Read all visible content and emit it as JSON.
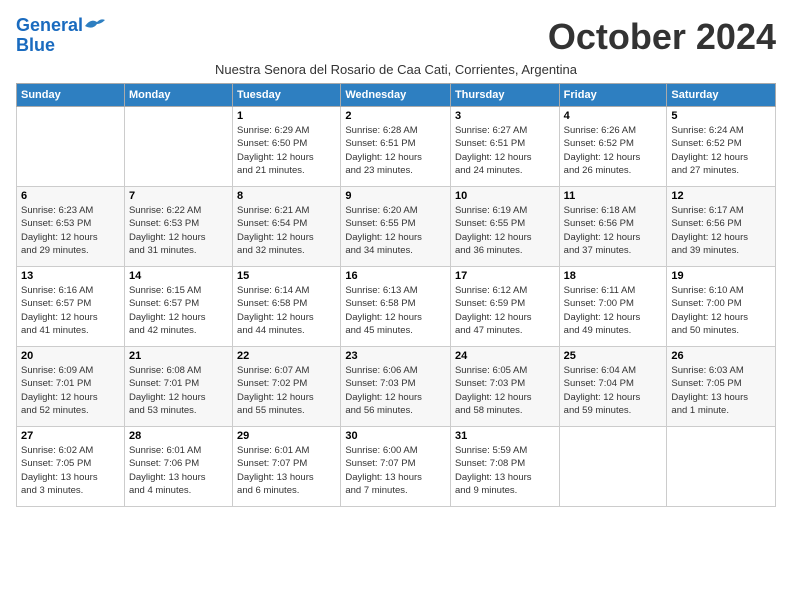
{
  "header": {
    "logo_line1": "General",
    "logo_line2": "Blue",
    "month_title": "October 2024",
    "subtitle": "Nuestra Senora del Rosario de Caa Cati, Corrientes, Argentina"
  },
  "weekdays": [
    "Sunday",
    "Monday",
    "Tuesday",
    "Wednesday",
    "Thursday",
    "Friday",
    "Saturday"
  ],
  "weeks": [
    [
      {
        "day": "",
        "info": ""
      },
      {
        "day": "",
        "info": ""
      },
      {
        "day": "1",
        "info": "Sunrise: 6:29 AM\nSunset: 6:50 PM\nDaylight: 12 hours\nand 21 minutes."
      },
      {
        "day": "2",
        "info": "Sunrise: 6:28 AM\nSunset: 6:51 PM\nDaylight: 12 hours\nand 23 minutes."
      },
      {
        "day": "3",
        "info": "Sunrise: 6:27 AM\nSunset: 6:51 PM\nDaylight: 12 hours\nand 24 minutes."
      },
      {
        "day": "4",
        "info": "Sunrise: 6:26 AM\nSunset: 6:52 PM\nDaylight: 12 hours\nand 26 minutes."
      },
      {
        "day": "5",
        "info": "Sunrise: 6:24 AM\nSunset: 6:52 PM\nDaylight: 12 hours\nand 27 minutes."
      }
    ],
    [
      {
        "day": "6",
        "info": "Sunrise: 6:23 AM\nSunset: 6:53 PM\nDaylight: 12 hours\nand 29 minutes."
      },
      {
        "day": "7",
        "info": "Sunrise: 6:22 AM\nSunset: 6:53 PM\nDaylight: 12 hours\nand 31 minutes."
      },
      {
        "day": "8",
        "info": "Sunrise: 6:21 AM\nSunset: 6:54 PM\nDaylight: 12 hours\nand 32 minutes."
      },
      {
        "day": "9",
        "info": "Sunrise: 6:20 AM\nSunset: 6:55 PM\nDaylight: 12 hours\nand 34 minutes."
      },
      {
        "day": "10",
        "info": "Sunrise: 6:19 AM\nSunset: 6:55 PM\nDaylight: 12 hours\nand 36 minutes."
      },
      {
        "day": "11",
        "info": "Sunrise: 6:18 AM\nSunset: 6:56 PM\nDaylight: 12 hours\nand 37 minutes."
      },
      {
        "day": "12",
        "info": "Sunrise: 6:17 AM\nSunset: 6:56 PM\nDaylight: 12 hours\nand 39 minutes."
      }
    ],
    [
      {
        "day": "13",
        "info": "Sunrise: 6:16 AM\nSunset: 6:57 PM\nDaylight: 12 hours\nand 41 minutes."
      },
      {
        "day": "14",
        "info": "Sunrise: 6:15 AM\nSunset: 6:57 PM\nDaylight: 12 hours\nand 42 minutes."
      },
      {
        "day": "15",
        "info": "Sunrise: 6:14 AM\nSunset: 6:58 PM\nDaylight: 12 hours\nand 44 minutes."
      },
      {
        "day": "16",
        "info": "Sunrise: 6:13 AM\nSunset: 6:58 PM\nDaylight: 12 hours\nand 45 minutes."
      },
      {
        "day": "17",
        "info": "Sunrise: 6:12 AM\nSunset: 6:59 PM\nDaylight: 12 hours\nand 47 minutes."
      },
      {
        "day": "18",
        "info": "Sunrise: 6:11 AM\nSunset: 7:00 PM\nDaylight: 12 hours\nand 49 minutes."
      },
      {
        "day": "19",
        "info": "Sunrise: 6:10 AM\nSunset: 7:00 PM\nDaylight: 12 hours\nand 50 minutes."
      }
    ],
    [
      {
        "day": "20",
        "info": "Sunrise: 6:09 AM\nSunset: 7:01 PM\nDaylight: 12 hours\nand 52 minutes."
      },
      {
        "day": "21",
        "info": "Sunrise: 6:08 AM\nSunset: 7:01 PM\nDaylight: 12 hours\nand 53 minutes."
      },
      {
        "day": "22",
        "info": "Sunrise: 6:07 AM\nSunset: 7:02 PM\nDaylight: 12 hours\nand 55 minutes."
      },
      {
        "day": "23",
        "info": "Sunrise: 6:06 AM\nSunset: 7:03 PM\nDaylight: 12 hours\nand 56 minutes."
      },
      {
        "day": "24",
        "info": "Sunrise: 6:05 AM\nSunset: 7:03 PM\nDaylight: 12 hours\nand 58 minutes."
      },
      {
        "day": "25",
        "info": "Sunrise: 6:04 AM\nSunset: 7:04 PM\nDaylight: 12 hours\nand 59 minutes."
      },
      {
        "day": "26",
        "info": "Sunrise: 6:03 AM\nSunset: 7:05 PM\nDaylight: 13 hours\nand 1 minute."
      }
    ],
    [
      {
        "day": "27",
        "info": "Sunrise: 6:02 AM\nSunset: 7:05 PM\nDaylight: 13 hours\nand 3 minutes."
      },
      {
        "day": "28",
        "info": "Sunrise: 6:01 AM\nSunset: 7:06 PM\nDaylight: 13 hours\nand 4 minutes."
      },
      {
        "day": "29",
        "info": "Sunrise: 6:01 AM\nSunset: 7:07 PM\nDaylight: 13 hours\nand 6 minutes."
      },
      {
        "day": "30",
        "info": "Sunrise: 6:00 AM\nSunset: 7:07 PM\nDaylight: 13 hours\nand 7 minutes."
      },
      {
        "day": "31",
        "info": "Sunrise: 5:59 AM\nSunset: 7:08 PM\nDaylight: 13 hours\nand 9 minutes."
      },
      {
        "day": "",
        "info": ""
      },
      {
        "day": "",
        "info": ""
      }
    ]
  ]
}
